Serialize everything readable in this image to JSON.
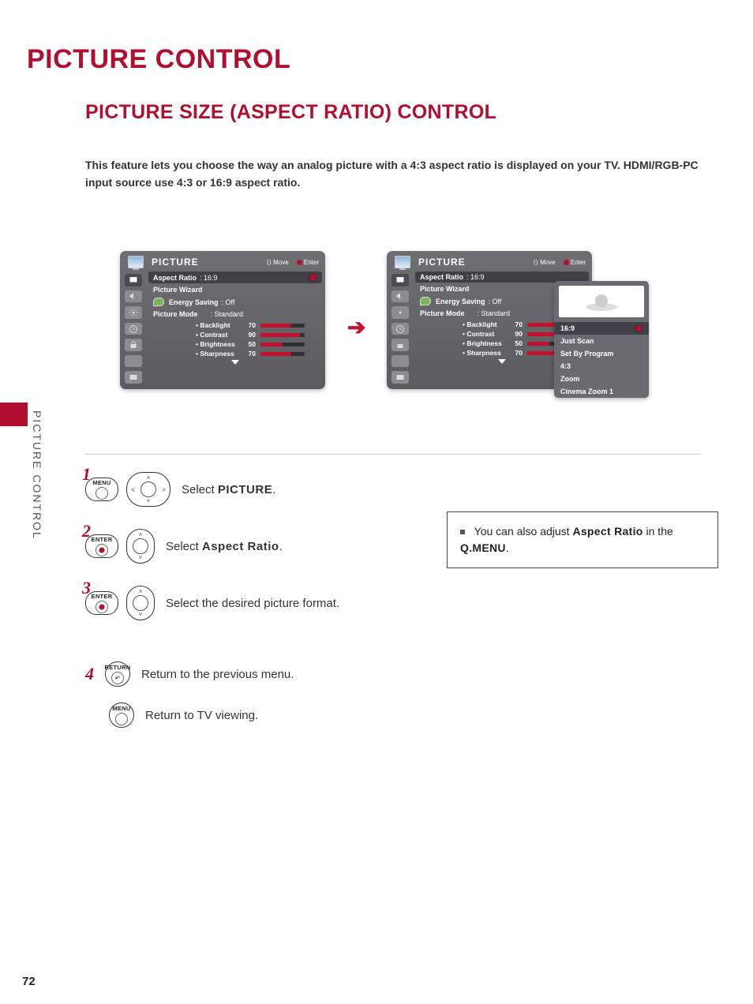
{
  "page": {
    "title": "PICTURE CONTROL",
    "subtitle": "PICTURE SIZE (ASPECT RATIO) CONTROL",
    "intro": "This feature lets you choose the way an analog picture with a 4:3 aspect ratio is displayed on your TV. HDMI/RGB-PC input source use 4:3 or 16:9 aspect ratio.",
    "sidelabel": "PICTURE CONTROL",
    "pagenum": "72"
  },
  "osd": {
    "head_title": "PICTURE",
    "hint_move": "Move",
    "hint_enter": "Enter",
    "rows": {
      "aspect_label": "Aspect Ratio",
      "aspect_value": ": 16:9",
      "wizard": "Picture Wizard",
      "energy_label": "Energy Saving",
      "energy_value": ": Off",
      "mode_label": "Picture Mode",
      "mode_value": ": Standard"
    },
    "sliders": [
      {
        "name": "• Backlight",
        "value": "70",
        "pct": 70
      },
      {
        "name": "• Contrast",
        "value": "90",
        "pct": 90
      },
      {
        "name": "• Brightness",
        "value": "50",
        "pct": 50
      },
      {
        "name": "• Sharpness",
        "value": "70",
        "pct": 70
      }
    ]
  },
  "flyout": {
    "options": [
      "16:9",
      "Just Scan",
      "Set By Program",
      "4:3",
      "Zoom",
      "Cinema Zoom 1"
    ],
    "selected": "16:9"
  },
  "steps": {
    "s1": {
      "btn": "MENU",
      "text_pre": "Select ",
      "text_bold": "PICTURE",
      "text_post": "."
    },
    "s2": {
      "btn": "ENTER",
      "text_pre": "Select ",
      "text_bold": "Aspect Ratio",
      "text_post": "."
    },
    "s3": {
      "btn": "ENTER",
      "text": "Select the desired picture format."
    },
    "s4": {
      "btn": "RETURN",
      "text": "Return to the previous menu."
    },
    "s5": {
      "btn": "MENU",
      "text": "Return to TV viewing."
    }
  },
  "tip": {
    "pre": "You can also adjust ",
    "b1": "Aspect Ratio",
    "mid": " in the ",
    "b2": "Q.MENU",
    "post": "."
  }
}
